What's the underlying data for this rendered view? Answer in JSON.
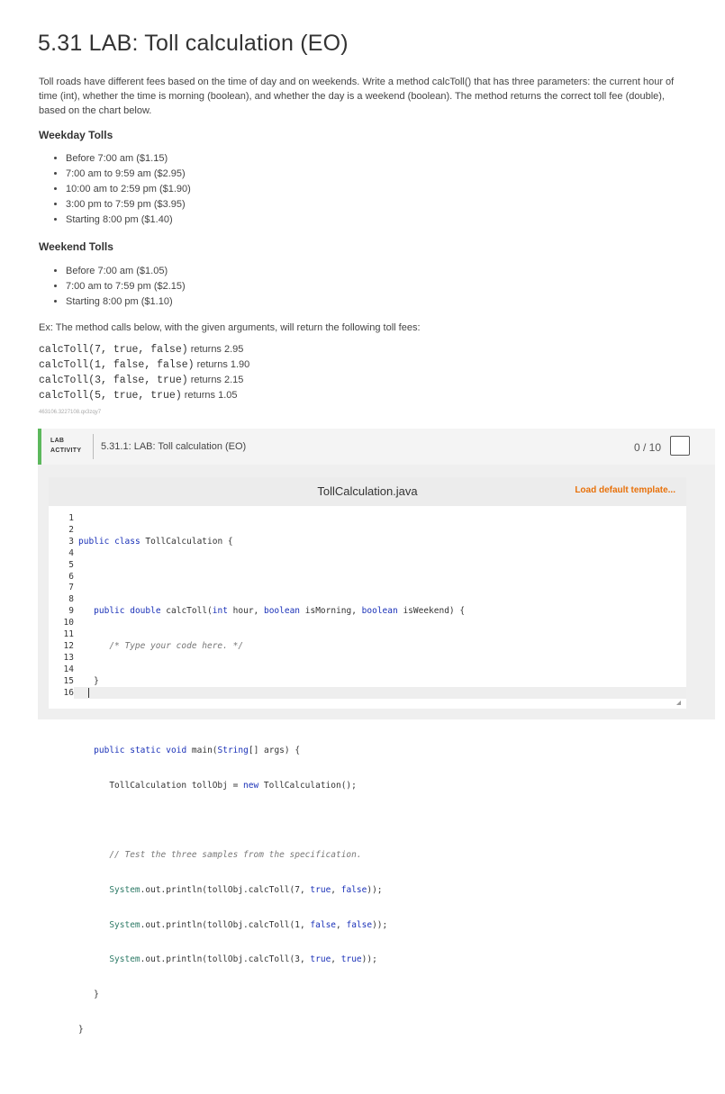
{
  "page": {
    "title": "5.31 LAB: Toll calculation (EO)",
    "intro": "Toll roads have different fees based on the time of day and on weekends. Write a method calcToll() that has three parameters: the current hour of time (int), whether the time is morning (boolean), and whether the day is a weekend (boolean). The method returns the correct toll fee (double), based on the chart below.",
    "weekday_heading": "Weekday Tolls",
    "weekday_items": [
      "Before 7:00 am ($1.15)",
      "7:00 am to 9:59 am ($2.95)",
      "10:00 am to 2:59 pm ($1.90)",
      "3:00 pm to 7:59 pm ($3.95)",
      "Starting 8:00 pm ($1.40)"
    ],
    "weekend_heading": "Weekend Tolls",
    "weekend_items": [
      "Before 7:00 am ($1.05)",
      "7:00 am to 7:59 pm ($2.15)",
      "Starting 8:00 pm ($1.10)"
    ],
    "example_intro": "Ex: The method calls below, with the given arguments, will return the following toll fees:",
    "examples": [
      {
        "code": "calcToll(7, true, false)",
        "result": " returns 2.95"
      },
      {
        "code": "calcToll(1, false, false)",
        "result": " returns 1.90"
      },
      {
        "code": "calcToll(3, false, true)",
        "result": " returns 2.15"
      },
      {
        "code": "calcToll(5, true, true)",
        "result": " returns 1.05"
      }
    ],
    "tracking_id": "463106.3227108.qx3zqy7"
  },
  "lab": {
    "tag_line1": "LAB",
    "tag_line2": "ACTIVITY",
    "name": "5.31.1: LAB: Toll calculation (EO)",
    "score": "0 / 10"
  },
  "editor": {
    "filename": "TollCalculation.java",
    "load_template": "Load default template...",
    "line_numbers": [
      "1",
      "2",
      "3",
      "4",
      "5",
      "6",
      "7",
      "8",
      "9",
      "10",
      "11",
      "12",
      "13",
      "14",
      "15",
      "16"
    ]
  },
  "colors": {
    "accent_green": "#5cb85c",
    "link_orange": "#e8710a",
    "keyword_blue": "#1a31b8"
  }
}
